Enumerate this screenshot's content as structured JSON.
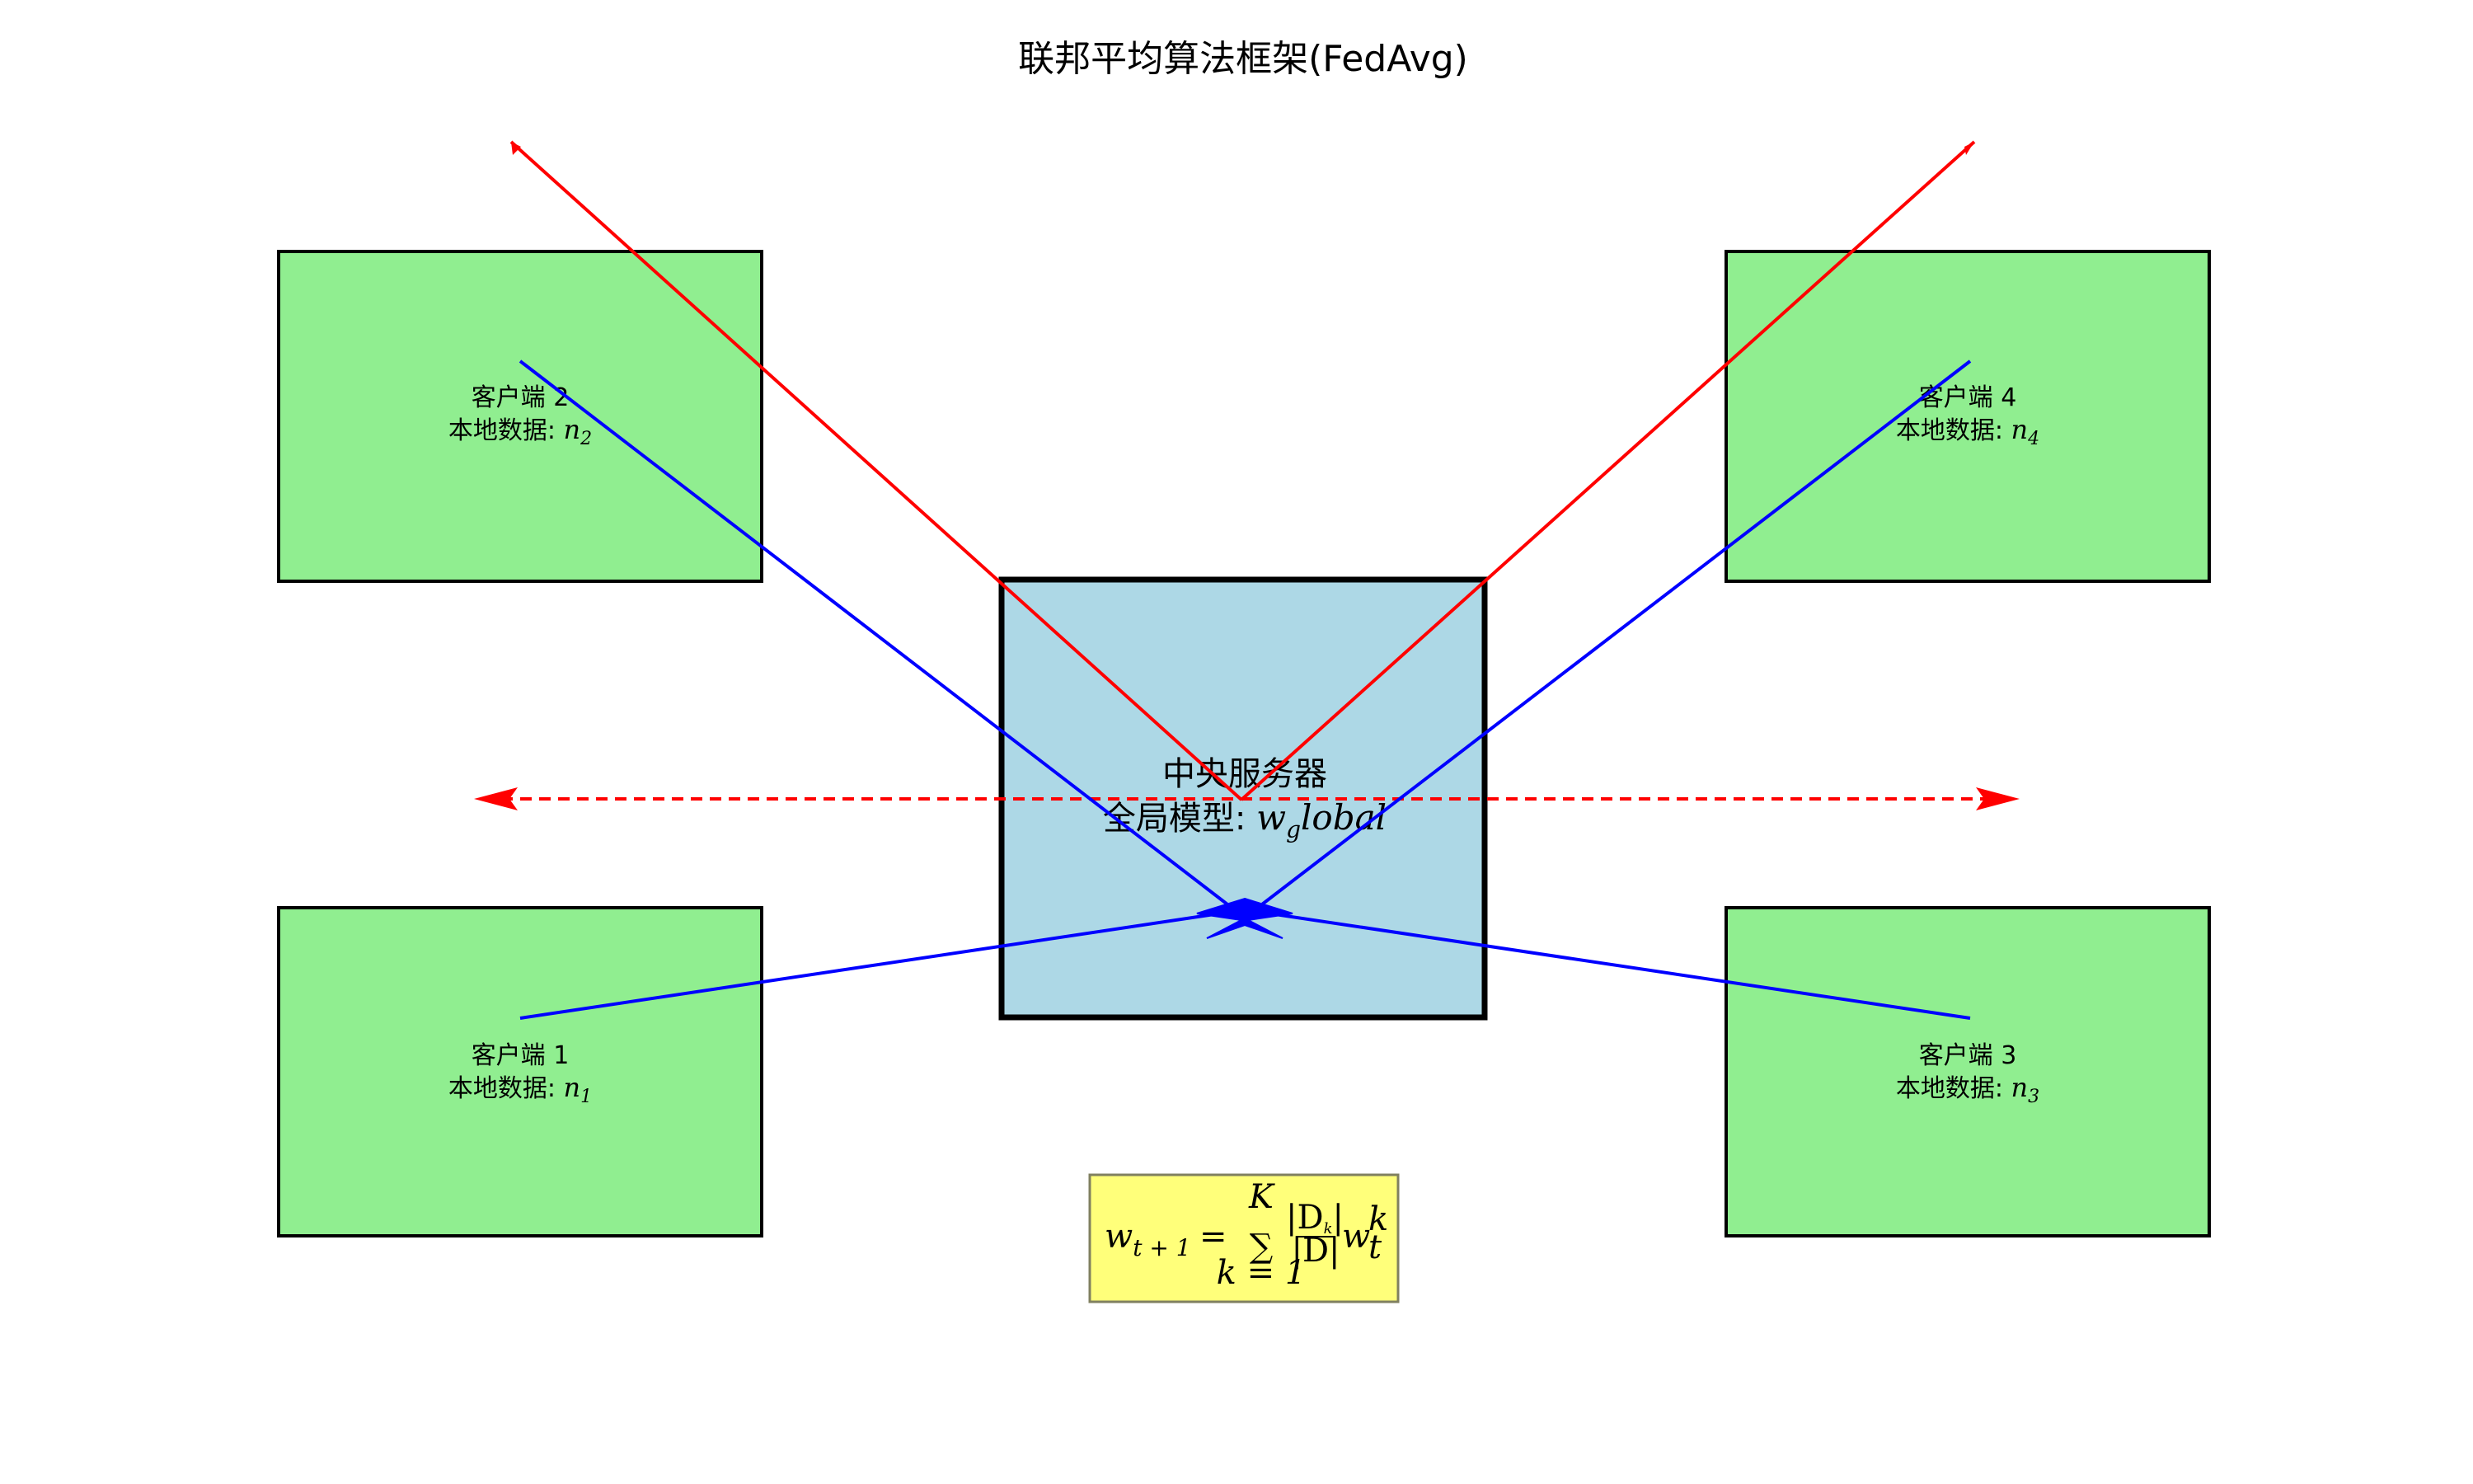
{
  "diagram": {
    "title": "联邦平均算法框架(FedAvg)",
    "server": {
      "label": "中央服务器",
      "model_prefix": "全局模型: ",
      "model_symbol": "w",
      "model_subscript": "g",
      "model_suffix": "lobal"
    },
    "clients": [
      {
        "id": "client-1",
        "name": "客户端 1",
        "data_prefix": "本地数据: ",
        "data_symbol": "n",
        "data_subscript": "1"
      },
      {
        "id": "client-2",
        "name": "客户端 2",
        "data_prefix": "本地数据: ",
        "data_symbol": "n",
        "data_subscript": "2"
      },
      {
        "id": "client-3",
        "name": "客户端 3",
        "data_prefix": "本地数据: ",
        "data_symbol": "n",
        "data_subscript": "3"
      },
      {
        "id": "client-4",
        "name": "客户端 4",
        "data_prefix": "本地数据: ",
        "data_symbol": "n",
        "data_subscript": "4"
      }
    ],
    "formula": {
      "lhs_symbol": "w",
      "lhs_subscript": "t + 1",
      "equals": "=",
      "sum_upper": "K",
      "sum_lower": "k = 1",
      "numerator": "|D",
      "numerator_sub": "k",
      "numerator_close": "|",
      "denominator": "|D|",
      "rhs_symbol": "w",
      "rhs_subscript": "t",
      "rhs_superscript": "k"
    },
    "colors": {
      "client_fill": "#90ee90",
      "server_fill": "#add8e6",
      "formula_fill": "#ffff7a",
      "upload_arrows": "#0000ff",
      "broadcast_arrows": "#ff0000"
    }
  }
}
